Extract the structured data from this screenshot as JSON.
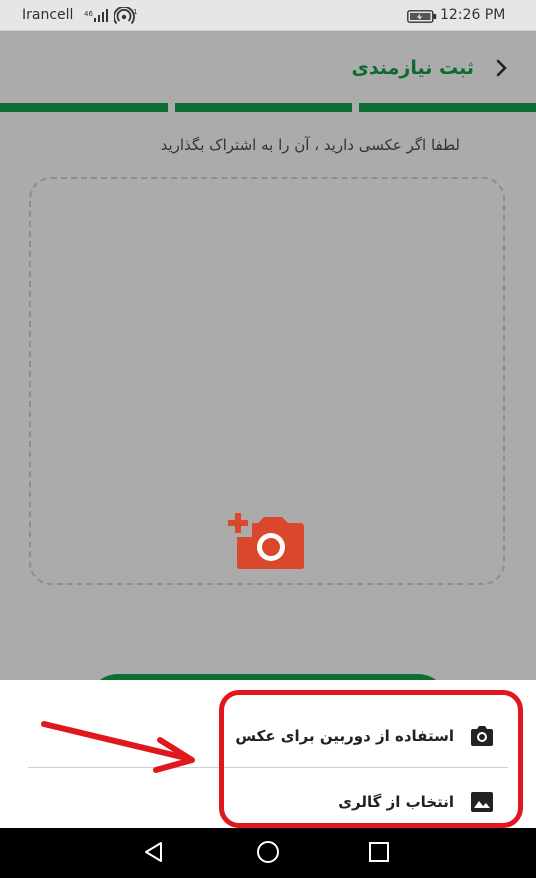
{
  "status_bar": {
    "carrier": "Irancell",
    "time": "12:26 PM",
    "icons": [
      "signal-icon",
      "hotspot-icon",
      "battery-icon"
    ]
  },
  "app_bar": {
    "title": "ثبت نیازمندی",
    "back_icon": "chevron-right-icon"
  },
  "progress": {
    "steps_total": 3,
    "steps_completed": 3,
    "color": "#0d6e33"
  },
  "main": {
    "prompt": "لطفا اگر عکسی دارید ، آن را به اشتراک بگذارید",
    "add_photo_icon": "add-photo-icon",
    "accent_color": "#d9482b"
  },
  "bottom_sheet": {
    "items": [
      {
        "label": "استفاده از دوربین برای عکس",
        "icon": "camera-icon"
      },
      {
        "label": "انتخاب از گالری",
        "icon": "gallery-icon"
      }
    ]
  },
  "annotation": {
    "color": "#e0181e",
    "icons": [
      "red-arrow",
      "highlight-box"
    ]
  },
  "nav_bar": {
    "icons": [
      "nav-back-icon",
      "nav-home-icon",
      "nav-recent-icon"
    ]
  }
}
